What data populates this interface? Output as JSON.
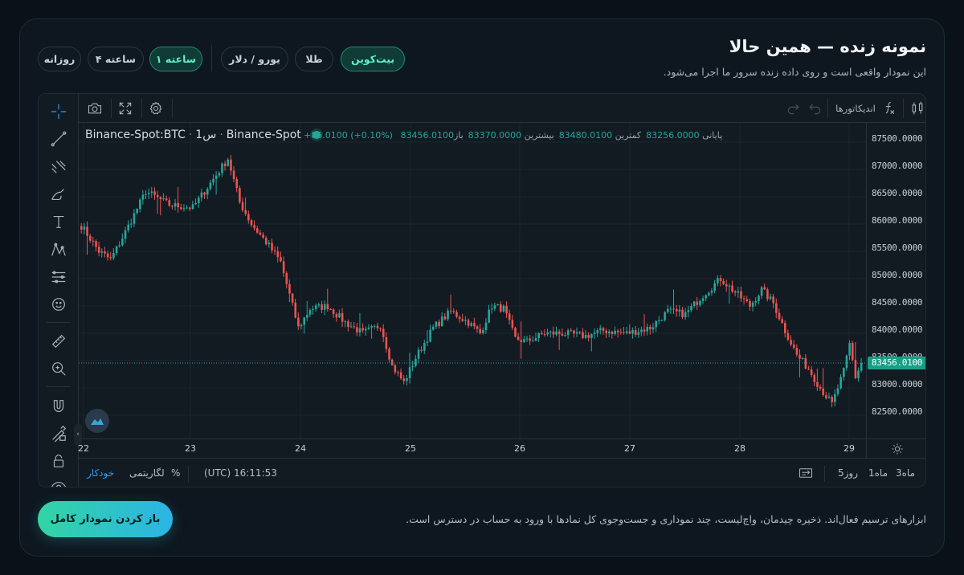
{
  "header": {
    "title": "نمونه زنده — همین حالا",
    "subtitle": "این نمودار واقعی است و روی داده زنده سرور ما اجرا می‌شود."
  },
  "symbol_tabs": [
    {
      "label": "بیت‌کوین",
      "active": true
    },
    {
      "label": "طلا",
      "active": false
    },
    {
      "label": "یورو / دلار",
      "active": false
    }
  ],
  "interval_tabs": [
    {
      "label": "۱ ساعته",
      "active": true
    },
    {
      "label": "۴ ساعته",
      "active": false
    },
    {
      "label": "روزانه",
      "active": false
    }
  ],
  "toolbar": {
    "interval": "1س",
    "indicators_label": "اندیکاتورها"
  },
  "legend": {
    "symbol": "Binance-Spot:BTC",
    "interval": "1س",
    "exchange": "Binance-Spot",
    "open_label": "باز",
    "open": "83370.0000",
    "high_label": "بیشترین",
    "high": "83480.0100",
    "low_label": "کمترین",
    "low": "83256.0000",
    "close_label": "پایانی",
    "close": "83456.0100",
    "change": "+86.0100 (+0.10%)"
  },
  "chart_data": {
    "type": "candlestick",
    "ylim": [
      82200,
      87800
    ],
    "y_ticks": [
      "87500.0000",
      "87000.0000",
      "86500.0000",
      "86000.0000",
      "85500.0000",
      "85000.0000",
      "84500.0000",
      "84000.0000",
      "83500.0000",
      "83000.0000",
      "82500.0000"
    ],
    "y_tick_values": [
      87500,
      87000,
      86500,
      86000,
      85500,
      85000,
      84500,
      84000,
      83500,
      83000,
      82500
    ],
    "x_ticks": [
      "22",
      "23",
      "24",
      "25",
      "26",
      "27",
      "28",
      "29"
    ],
    "current_price": "83456.0100",
    "current_price_value": 83456.01,
    "colors": {
      "up": "#26a69a",
      "down": "#ef5350"
    },
    "anchors": [
      [
        0,
        85970
      ],
      [
        6,
        85500
      ],
      [
        10,
        85350
      ],
      [
        14,
        85750
      ],
      [
        22,
        86600
      ],
      [
        30,
        86350
      ],
      [
        38,
        86300
      ],
      [
        44,
        86750
      ],
      [
        50,
        87200
      ],
      [
        54,
        86400
      ],
      [
        58,
        86000
      ],
      [
        64,
        85600
      ],
      [
        68,
        85300
      ],
      [
        71,
        84700
      ],
      [
        74,
        84100
      ],
      [
        78,
        84450
      ],
      [
        84,
        84500
      ],
      [
        90,
        84200
      ],
      [
        96,
        84000
      ],
      [
        102,
        84150
      ],
      [
        106,
        83400
      ],
      [
        110,
        83100
      ],
      [
        114,
        83550
      ],
      [
        120,
        84100
      ],
      [
        126,
        84400
      ],
      [
        132,
        84200
      ],
      [
        136,
        84000
      ],
      [
        140,
        84500
      ],
      [
        144,
        84450
      ],
      [
        148,
        83900
      ],
      [
        152,
        83850
      ],
      [
        158,
        84000
      ],
      [
        164,
        84000
      ],
      [
        172,
        83950
      ],
      [
        178,
        84050
      ],
      [
        186,
        84000
      ],
      [
        194,
        84100
      ],
      [
        200,
        84400
      ],
      [
        206,
        84350
      ],
      [
        212,
        84700
      ],
      [
        218,
        85000
      ],
      [
        224,
        84700
      ],
      [
        228,
        84500
      ],
      [
        232,
        84800
      ],
      [
        236,
        84550
      ],
      [
        240,
        84050
      ],
      [
        244,
        83600
      ],
      [
        248,
        83350
      ],
      [
        252,
        83000
      ],
      [
        256,
        82700
      ],
      [
        260,
        83300
      ],
      [
        262,
        83800
      ],
      [
        264,
        83200
      ],
      [
        266,
        83456
      ]
    ]
  },
  "time_axis": {
    "timezone": "(UTC)",
    "time": "16:11:53",
    "percent": "%",
    "log": "لگاریتمی",
    "auto": "خودکار",
    "ranges": [
      "5روز",
      "1ماه",
      "3ماه"
    ]
  },
  "footer": {
    "note": "ابزارهای ترسیم فعال‌اند. ذخیره چیدمان، واچ‌لیست، چند نموداری و جست‌وجوی کل نمادها با ورود به حساب در دسترس است.",
    "cta": "باز کردن نمودار کامل"
  }
}
